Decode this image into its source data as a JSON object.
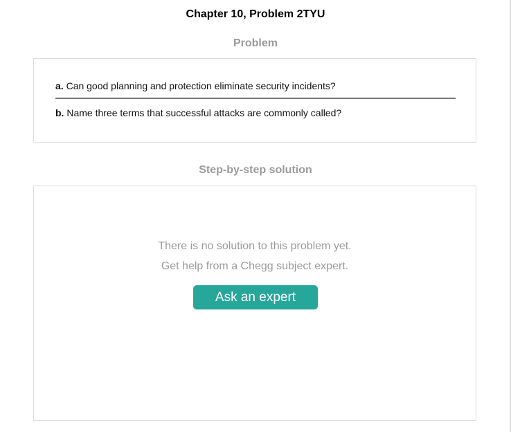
{
  "title": "Chapter 10, Problem 2TYU",
  "problem": {
    "heading": "Problem",
    "questions": [
      {
        "letter": "a.",
        "text": "Can good planning and protection eliminate security incidents?"
      },
      {
        "letter": "b.",
        "text": "Name three terms that successful attacks are commonly called?"
      }
    ]
  },
  "solution": {
    "heading": "Step-by-step solution",
    "empty_line_1": "There is no solution to this problem yet.",
    "empty_line_2": "Get help from a Chegg subject expert.",
    "ask_button_label": "Ask an expert"
  },
  "colors": {
    "accent": "#27a69a",
    "muted_text": "#9a9a9a",
    "border": "#dcdcdc"
  }
}
